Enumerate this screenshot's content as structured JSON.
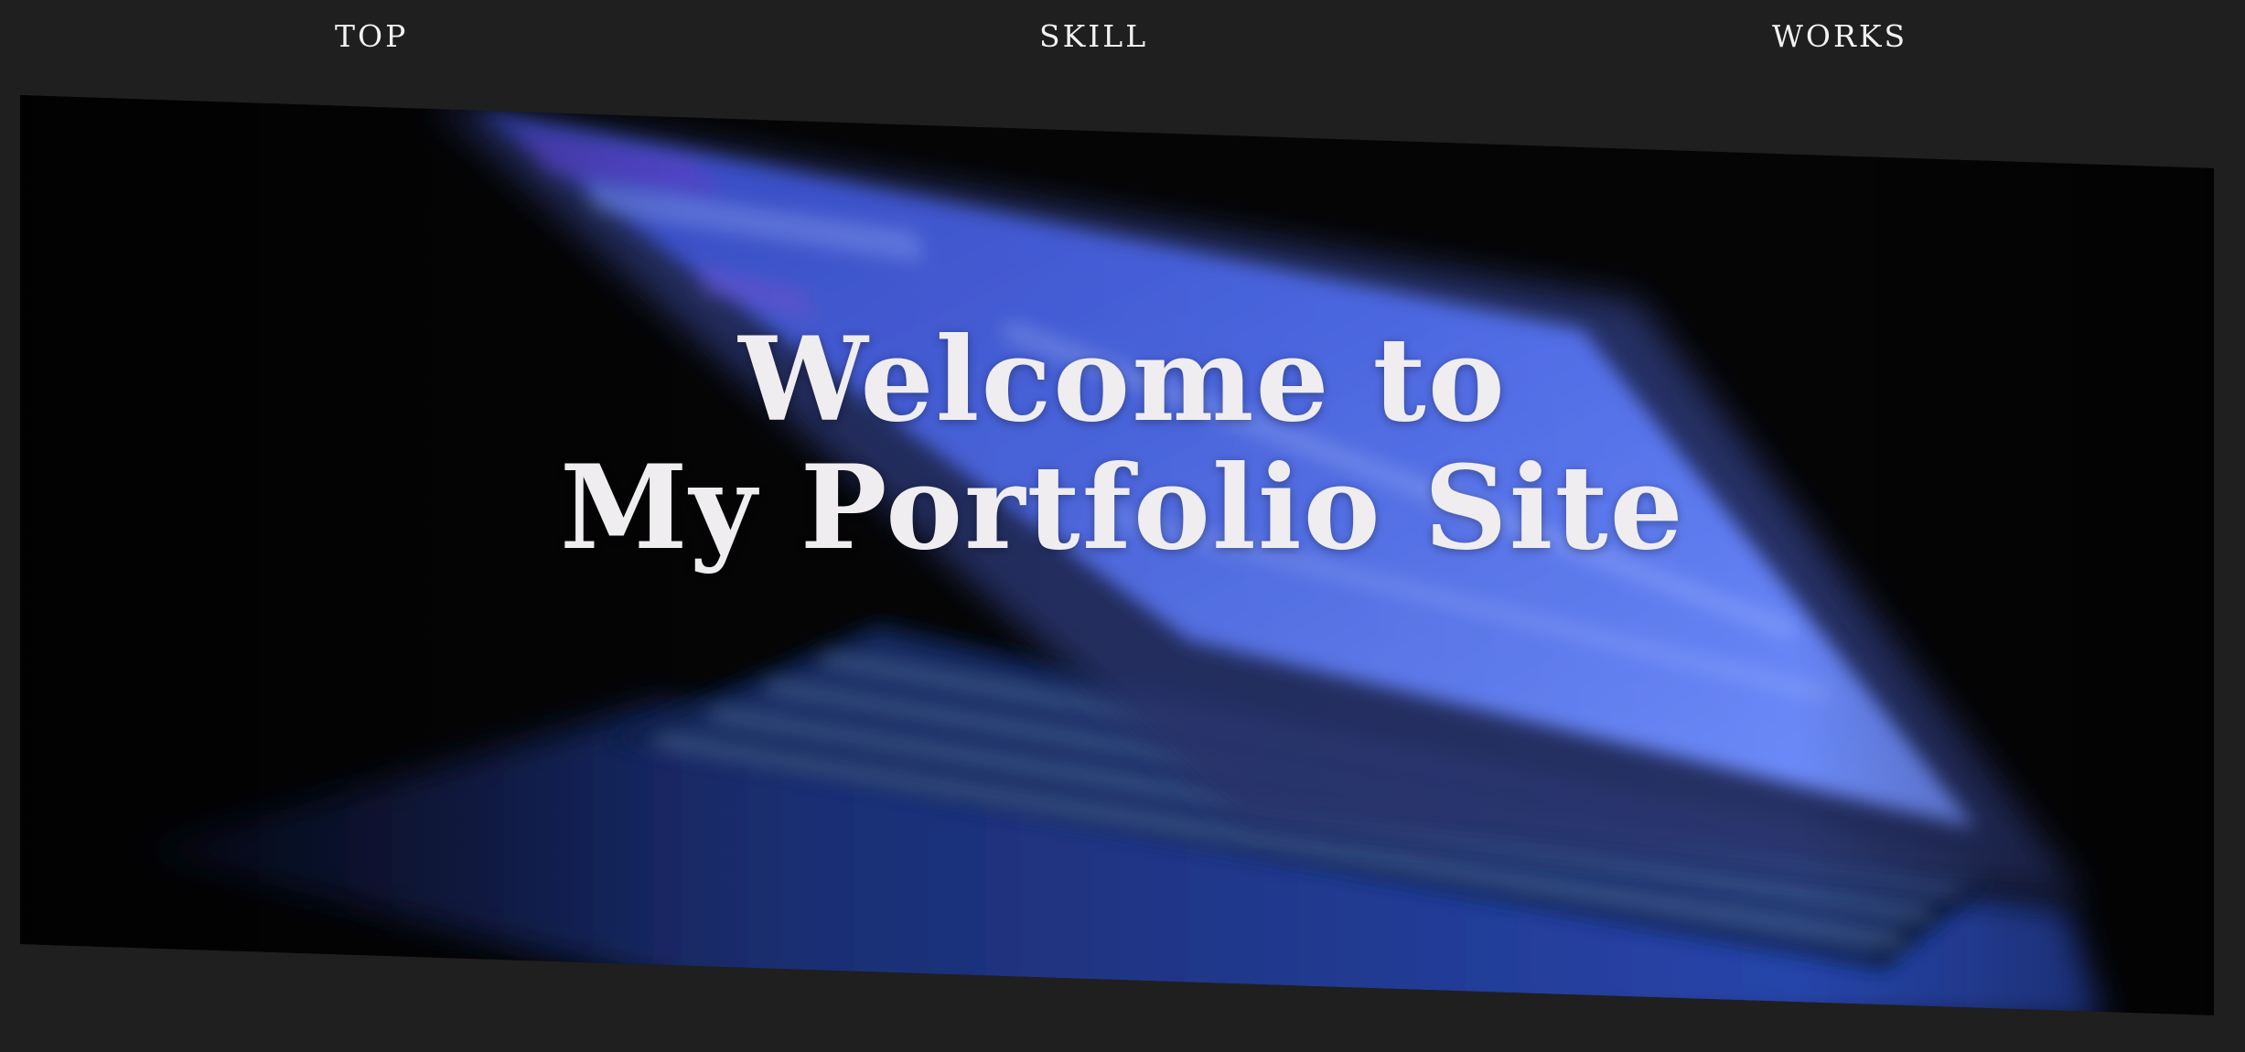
{
  "nav": {
    "items": [
      {
        "label": "TOP"
      },
      {
        "label": "SKILL"
      },
      {
        "label": "WORKS"
      }
    ]
  },
  "hero": {
    "title_line1": "Welcome to",
    "title_line2": "My Portfolio Site",
    "image_icon": "blurred-laptop-image"
  },
  "colors": {
    "page_background": "#1f1f1f",
    "nav_text": "#f2f2f2",
    "title_text": "#efedf0",
    "screen_glow": "#5b78f0"
  }
}
